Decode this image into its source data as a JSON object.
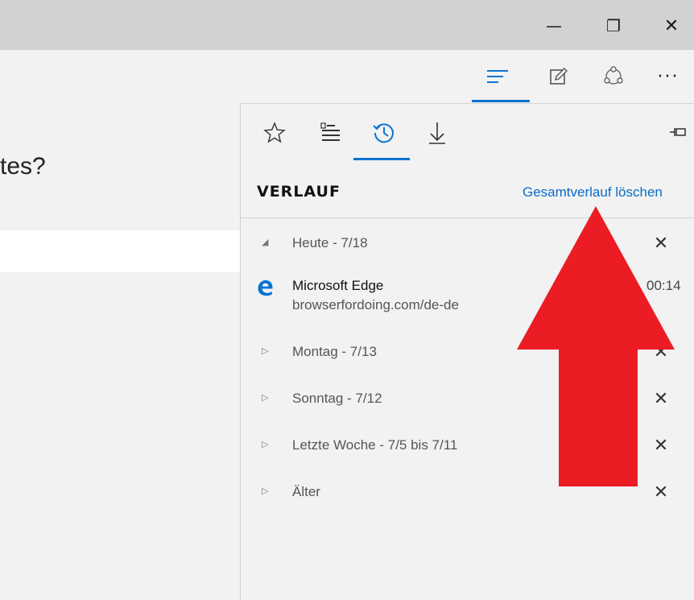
{
  "window": {
    "minimize_glyph": "—",
    "maximize_glyph": "❐",
    "close_glyph": "✕"
  },
  "toolbar": {
    "more_glyph": "···",
    "icons": [
      "hub-icon",
      "web-note-icon",
      "share-icon",
      "more-icon"
    ]
  },
  "page": {
    "partial_heading": "tes?"
  },
  "hub": {
    "tabs": [
      "favorites-icon",
      "reading-list-icon",
      "history-icon",
      "downloads-icon"
    ],
    "active_tab": "history-icon",
    "title": "VERLAUF",
    "clear_link": "Gesamtverlauf löschen",
    "groups": [
      {
        "label": "Heute - 7/18",
        "expanded": true
      },
      {
        "label": "Montag - 7/13",
        "expanded": false
      },
      {
        "label": "Sonntag - 7/12",
        "expanded": false
      },
      {
        "label": "Letzte Woche - 7/5 bis 7/11",
        "expanded": false
      },
      {
        "label": "Älter",
        "expanded": false
      }
    ],
    "entry": {
      "title": "Microsoft Edge",
      "url": "browserfordoing.com/de-de",
      "time": "00:14"
    },
    "close_glyph": "✕",
    "expanded_caret": "◢",
    "collapsed_caret": "▷"
  },
  "colors": {
    "accent": "#0b74d1",
    "annotation_arrow": "#ec1c24",
    "titlebar": "#d2d2d2",
    "panel": "#f2f2f2"
  }
}
